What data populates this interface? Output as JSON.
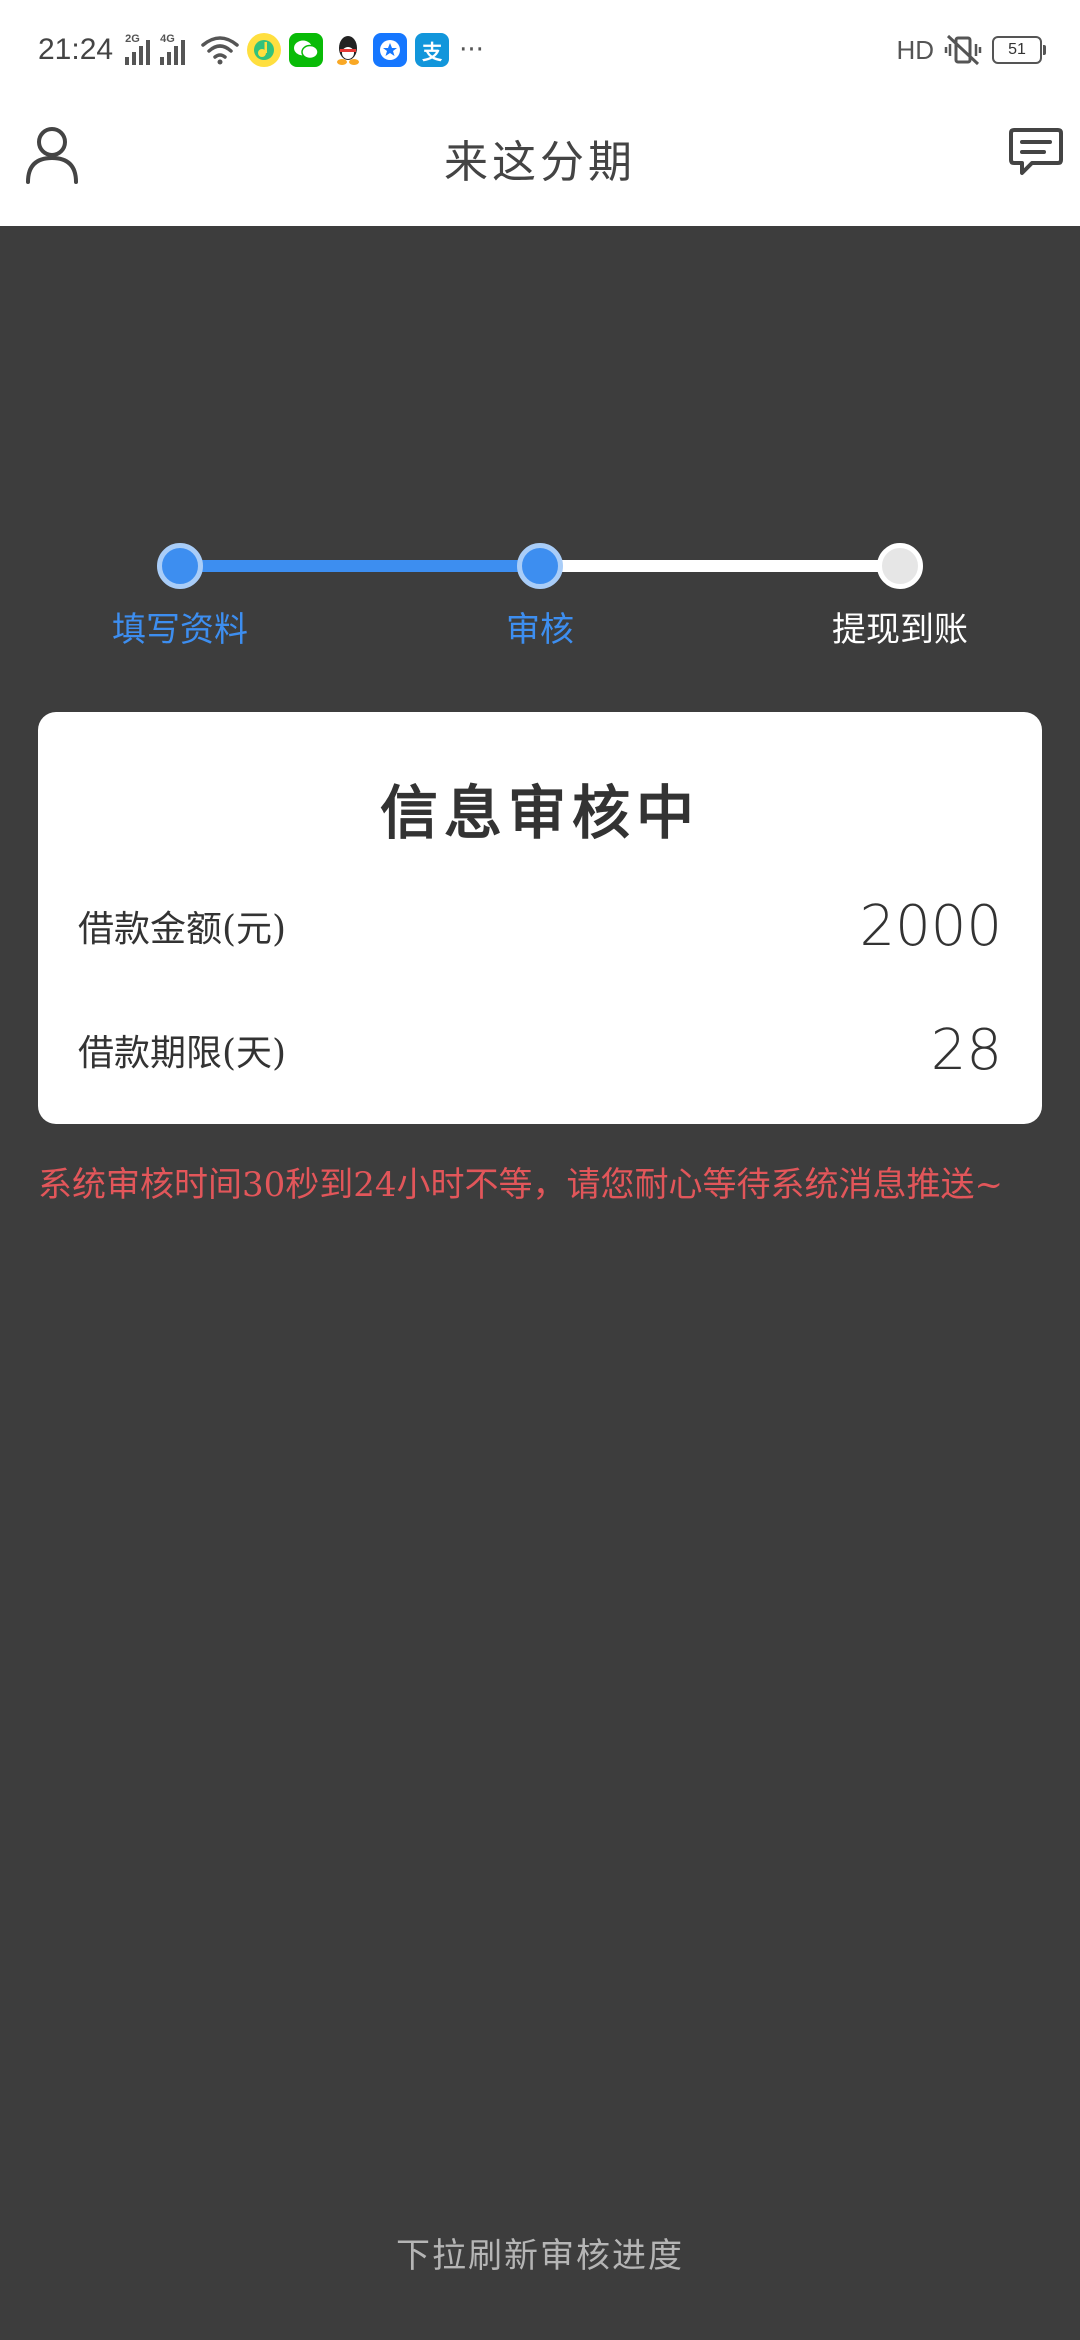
{
  "status_bar": {
    "time": "21:24",
    "signal_1": "2G",
    "signal_2": "4G",
    "more": "···",
    "hd": "HD",
    "battery": "51",
    "icons": [
      "wifi-icon",
      "qq-music-icon",
      "wechat-icon",
      "qq-icon",
      "app-star-icon",
      "alipay-icon",
      "vibrate-icon"
    ]
  },
  "header": {
    "title": "来这分期",
    "left_icon": "user-icon",
    "right_icon": "message-icon"
  },
  "steps": {
    "items": [
      {
        "label": "填写资料",
        "state": "done"
      },
      {
        "label": "审核",
        "state": "done"
      },
      {
        "label": "提现到账",
        "state": "todo"
      }
    ],
    "active_color": "#3d8ef0",
    "inactive_color": "#ffffff"
  },
  "card": {
    "title": "信息审核中",
    "rows": [
      {
        "label": "借款金额(元)",
        "value": "2000"
      },
      {
        "label": "借款期限(天)",
        "value": "28"
      }
    ]
  },
  "notice": "系统审核时间30秒到24小时不等，请您耐心等待系统消息推送~",
  "footer_hint": "下拉刷新审核进度",
  "colors": {
    "background": "#3d3d3d",
    "notice": "#e2565a",
    "accent": "#3d8ef0"
  }
}
